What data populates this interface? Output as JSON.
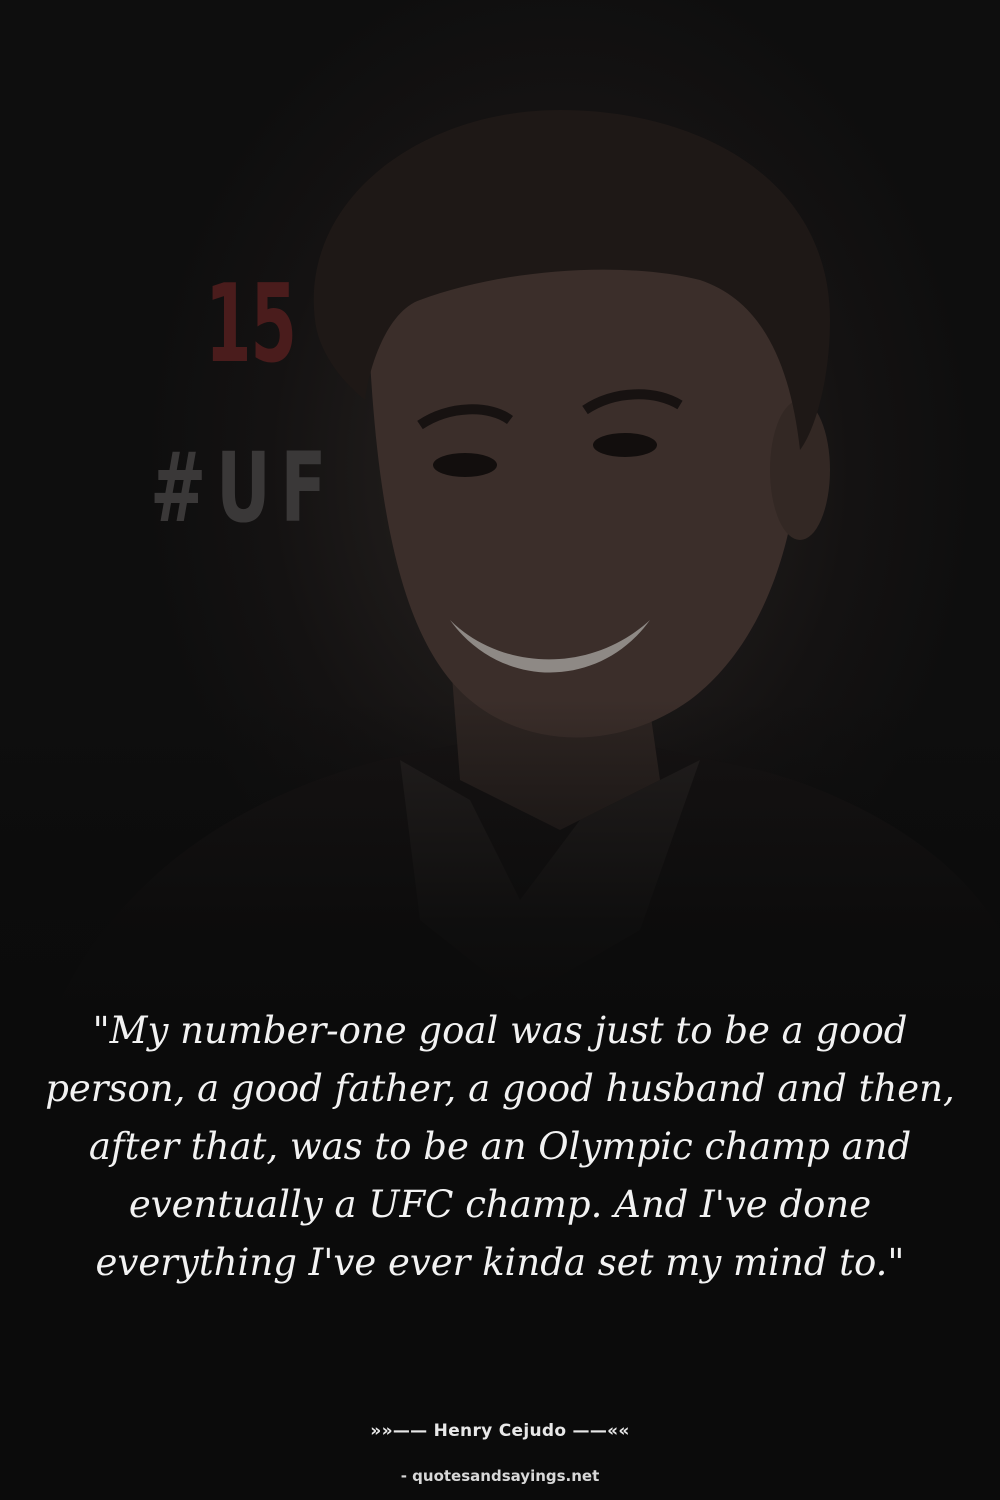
{
  "background": {
    "sign_number": "15",
    "sign_hashtag": "#UF",
    "sign_number_color": "#4a1c1c"
  },
  "quote": {
    "text": "\"My number-one goal was just to be a good person, a good father, a good husband and then, after that, was to be an Olympic champ and eventually a UFC champ. And I've done everything I've ever kinda set my mind to.\""
  },
  "author": {
    "line": "»»—— Henry Cejudo ——««"
  },
  "source": {
    "text": "- quotesandsayings.net"
  }
}
